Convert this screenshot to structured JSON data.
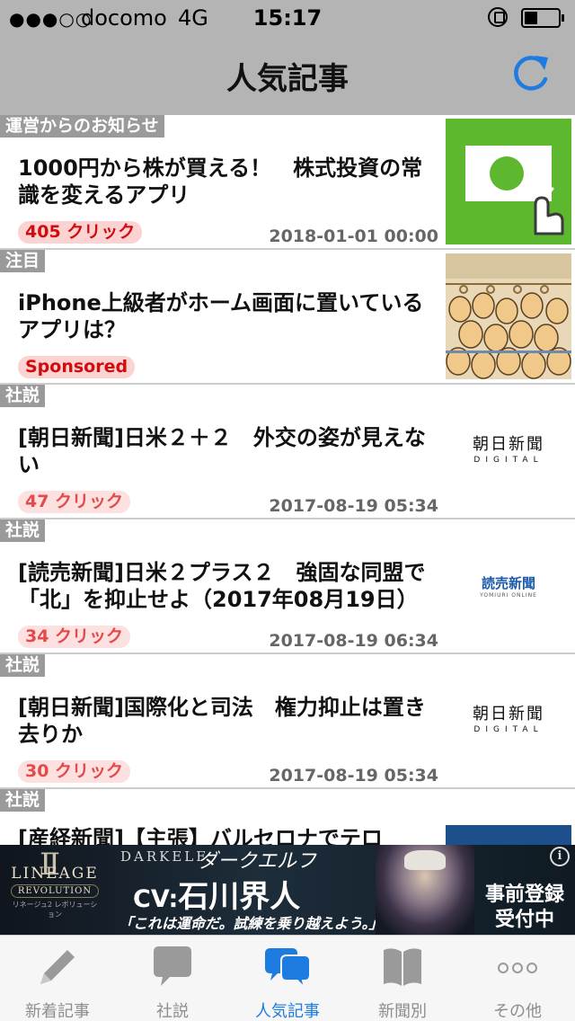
{
  "status_bar": {
    "signal": "●●●○○",
    "carrier": "docomo",
    "network": "4G",
    "time": "15:17"
  },
  "nav": {
    "title": "人気記事"
  },
  "articles": [
    {
      "tag": "運営からのお知らせ",
      "headline": "1000円から株が買える！　株式投資の常識を変えるアプリ",
      "badge": "405 クリック",
      "date": "2018-01-01 00:00",
      "thumb": "green-stock-app-icon"
    },
    {
      "tag": "注目",
      "headline": "iPhone上級者がホーム画面に置いているアプリは？",
      "badge": "Sponsored",
      "date": "",
      "thumb": "crowded-train-illustration"
    },
    {
      "tag": "社説",
      "headline": "[朝日新聞]日米２＋２　外交の姿が見えない",
      "badge": "47 クリック",
      "date": "2017-08-19 05:34",
      "logo": {
        "kanji": "朝日新聞",
        "sub": "DIGITAL"
      }
    },
    {
      "tag": "社説",
      "headline": "[読売新聞]日米２プラス２　強固な同盟で「北」を抑止せよ（2017年08月19日）",
      "badge": "34 クリック",
      "date": "2017-08-19 06:34",
      "logo": {
        "kanji": "読売新聞",
        "sub": "YOMIURI ONLINE"
      }
    },
    {
      "tag": "社説",
      "headline": "[朝日新聞]国際化と司法　権力抑止は置き去りか",
      "badge": "30 クリック",
      "date": "2017-08-19 05:34",
      "logo": {
        "kanji": "朝日新聞",
        "sub": "DIGITAL"
      }
    },
    {
      "tag": "社説",
      "headline": "[産経新聞]【主張】バルセロナでテロ"
    }
  ],
  "ad": {
    "brand_line1": "LINEAGE",
    "brand_line2": "REVOLUTION",
    "brand_line3": "リネージュ2 レボリューション",
    "title_en": "DARKELF",
    "title_jp": "ダークエルフ",
    "cv_prefix": "CV:",
    "cv_name": "石川界人",
    "quote": "「これは運命だ。試練を乗り越えよう。」",
    "cta_line1": "事前登録",
    "cta_line2": "受付中",
    "info": "i"
  },
  "tabs": [
    {
      "label": "新着記事",
      "icon": "pencil-icon"
    },
    {
      "label": "社説",
      "icon": "speech-bubble-icon"
    },
    {
      "label": "人気記事",
      "icon": "double-speech-bubble-icon",
      "active": true
    },
    {
      "label": "新聞別",
      "icon": "book-icon"
    },
    {
      "label": "その他",
      "icon": "more-dots-icon"
    }
  ],
  "colors": {
    "accent": "#1e7be0",
    "nav_bg": "#b4b4b4",
    "tag_bg": "#9a9a9a",
    "badge_text": "#d20c0c",
    "badge_bg": "#fcd3d3"
  }
}
